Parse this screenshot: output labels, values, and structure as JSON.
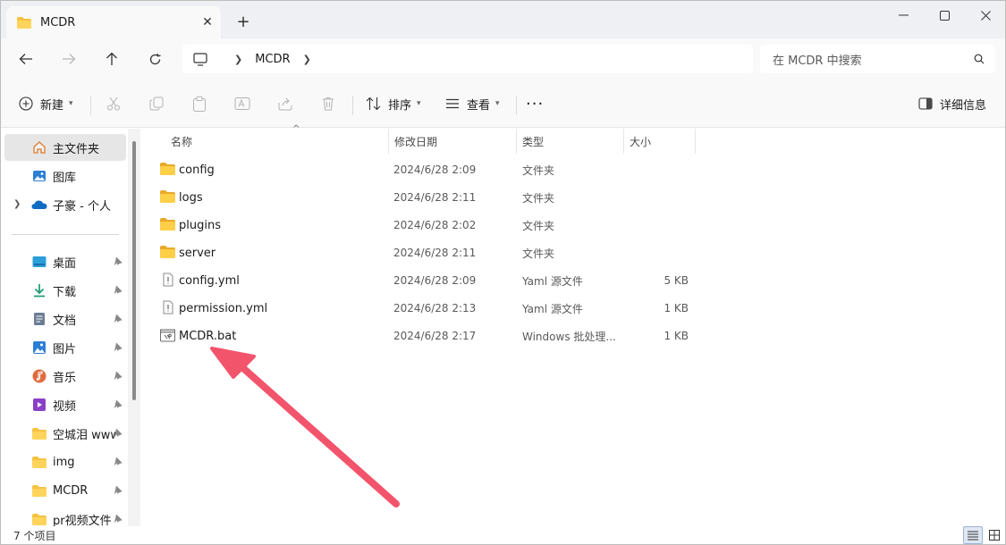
{
  "tab": {
    "title": "MCDR"
  },
  "address": {
    "crumbs": [
      "MCDR"
    ]
  },
  "search": {
    "placeholder": "在 MCDR 中搜索"
  },
  "commands": {
    "new": "新建",
    "sort": "排序",
    "view": "查看",
    "details": "详细信息"
  },
  "sidebar": {
    "items": [
      {
        "label": "主文件夹",
        "icon": "home-icon"
      },
      {
        "label": "图库",
        "icon": "gallery-icon"
      },
      {
        "label": "子豪 - 个人",
        "icon": "onedrive-cloud-icon"
      },
      {
        "label": "桌面",
        "icon": "desktop-icon"
      },
      {
        "label": "下载",
        "icon": "download-icon"
      },
      {
        "label": "文档",
        "icon": "document-icon"
      },
      {
        "label": "图片",
        "icon": "picture-icon"
      },
      {
        "label": "音乐",
        "icon": "music-icon"
      },
      {
        "label": "视频",
        "icon": "video-icon"
      },
      {
        "label": "空城泪 www",
        "icon": "folder-icon"
      },
      {
        "label": "img",
        "icon": "folder-icon"
      },
      {
        "label": "MCDR",
        "icon": "folder-icon"
      },
      {
        "label": "pr视频文件",
        "icon": "folder-icon"
      }
    ]
  },
  "columns": {
    "name": "名称",
    "modified": "修改日期",
    "type": "类型",
    "size": "大小"
  },
  "files": [
    {
      "name": "config",
      "date": "2024/6/28 2:09",
      "type": "文件夹",
      "size": "",
      "icon": "folder-icon"
    },
    {
      "name": "logs",
      "date": "2024/6/28 2:11",
      "type": "文件夹",
      "size": "",
      "icon": "folder-icon"
    },
    {
      "name": "plugins",
      "date": "2024/6/28 2:02",
      "type": "文件夹",
      "size": "",
      "icon": "folder-icon"
    },
    {
      "name": "server",
      "date": "2024/6/28 2:11",
      "type": "文件夹",
      "size": "",
      "icon": "folder-icon"
    },
    {
      "name": "config.yml",
      "date": "2024/6/28 2:09",
      "type": "Yaml 源文件",
      "size": "5 KB",
      "icon": "yaml-file-icon"
    },
    {
      "name": "permission.yml",
      "date": "2024/6/28 2:13",
      "type": "Yaml 源文件",
      "size": "1 KB",
      "icon": "yaml-file-icon"
    },
    {
      "name": "MCDR.bat",
      "date": "2024/6/28 2:17",
      "type": "Windows 批处理...",
      "size": "1 KB",
      "icon": "batch-file-icon"
    }
  ],
  "status": {
    "item_count": "7 个项目"
  },
  "colors": {
    "folder": "#f5c242",
    "arrow": "#f2546c",
    "accent": "#0067c0"
  }
}
